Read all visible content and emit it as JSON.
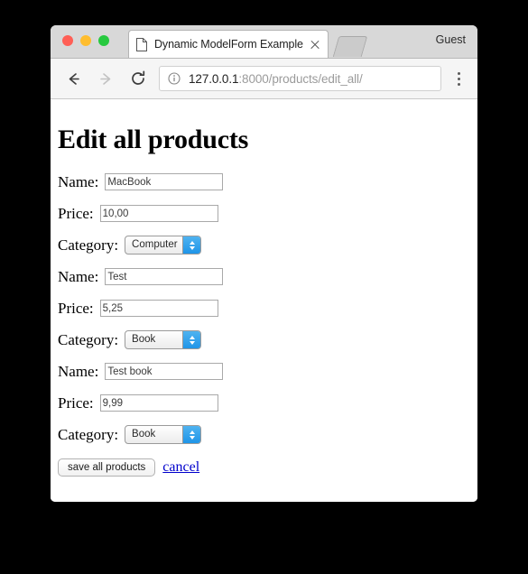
{
  "window": {
    "traffic_lights": [
      {
        "name": "close",
        "color": "#ff5f56"
      },
      {
        "name": "minimize",
        "color": "#ffbd2e"
      },
      {
        "name": "zoom",
        "color": "#27c93f"
      }
    ]
  },
  "tabbar": {
    "tab_title": "Dynamic ModelForm Example",
    "close_label": "",
    "profile_label": "Guest"
  },
  "toolbar": {
    "back_label": "",
    "forward_label": "",
    "reload_label": "",
    "url_host": "127.0.0.1",
    "url_rest": ":8000/products/edit_all/",
    "menu_label": ""
  },
  "page": {
    "title": "Edit all products",
    "labels": {
      "name": "Name:",
      "price": "Price:",
      "category": "Category:"
    },
    "products": [
      {
        "name": "MacBook",
        "price": "10,00",
        "category": "Computer"
      },
      {
        "name": "Test",
        "price": "5,25",
        "category": "Book"
      },
      {
        "name": "Test book",
        "price": "9,99",
        "category": "Book"
      }
    ],
    "save_label": "save all products",
    "cancel_label": "cancel"
  }
}
